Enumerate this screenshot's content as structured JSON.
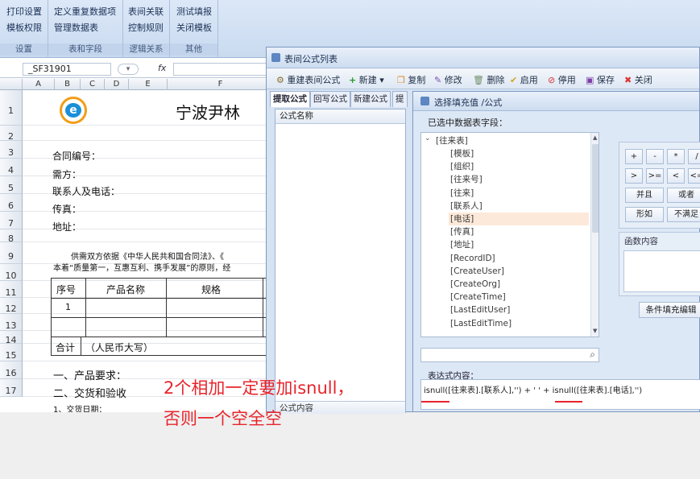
{
  "ribbon": {
    "groups": [
      {
        "buttons": [
          "打印设置",
          "模板权限"
        ],
        "label": "设置"
      },
      {
        "buttons": [
          "定义重复数据项",
          "管理数据表"
        ],
        "label": "表和字段"
      },
      {
        "buttons": [
          "表间关联",
          "控制规则"
        ],
        "label": "逻辑关系"
      },
      {
        "buttons": [
          "测试填报",
          "关闭模板"
        ],
        "label": "其他"
      }
    ]
  },
  "formula_bar": {
    "cell_ref": "_SF31901",
    "fx": "fx"
  },
  "sheet": {
    "columns": [
      "A",
      "B",
      "C",
      "D",
      "E",
      "F"
    ],
    "rows": [
      "1",
      "2",
      "3",
      "4",
      "5",
      "6",
      "7",
      "8",
      "9",
      "10",
      "11",
      "12",
      "13",
      "14",
      "15",
      "16",
      "17"
    ],
    "title": "宁波尹林",
    "lines": {
      "contract_no": "合同编号：",
      "buyer": "需方：",
      "contact": "联系人及电话：",
      "fax": "传真：",
      "address": "地址：",
      "para1": "供需双方依据《中华人民共和国合同法》、《",
      "para2": "本着“质量第一，互惠互利、携手发展”的原则，经",
      "th_no": "序号",
      "th_name": "产品名称",
      "th_spec": "规格",
      "row1_no": "1",
      "total": "合计",
      "total_rmb": "（人民币大写）",
      "sec1": "一、产品要求：",
      "sec2": "二、交货和验收",
      "sec2_1": "1、交货日期："
    }
  },
  "formula_window": {
    "title": "表间公式列表",
    "toolbar": [
      "重建表间公式",
      "新建",
      "复制",
      "修改",
      "删除",
      "启用",
      "停用",
      "保存",
      "关闭"
    ],
    "tabs": [
      "提取公式",
      "回写公式",
      "新建公式",
      "提"
    ],
    "list_header": "公式名称",
    "bottom_label": "公式内容"
  },
  "fill_dialog": {
    "title": "选择填充值 /公式",
    "fields_label": "已选中数据表字段：",
    "tree_root": "[往来表]",
    "tree_items": [
      "[模板]",
      "[组织]",
      "[往来号]",
      "[往来]",
      "[联系人]",
      "[电话]",
      "[传真]",
      "[地址]",
      "[RecordID]",
      "[CreateUser]",
      "[CreateOrg]",
      "[CreateTime]",
      "[LastEditUser]",
      "[LastEditTime]"
    ],
    "selected_item": "[电话]",
    "keys_row1": [
      "+",
      "-",
      "*",
      "/"
    ],
    "keys_row2": [
      ">",
      ">=",
      "<",
      "<="
    ],
    "keys_row3": [
      "并且",
      "或者"
    ],
    "keys_row4": [
      "形如",
      "不满足"
    ],
    "func_label": "函数内容",
    "cond_button": "条件填充编辑",
    "expr_label": "表达式内容：",
    "expression": "isnull([往来表].[联系人],'') + ' ' + isnull([往来表].[电话],'')"
  },
  "annotation": {
    "line1": "2个相加一定要加isnull，",
    "line2": "否则一个空全空",
    "color": "#e8242b"
  }
}
